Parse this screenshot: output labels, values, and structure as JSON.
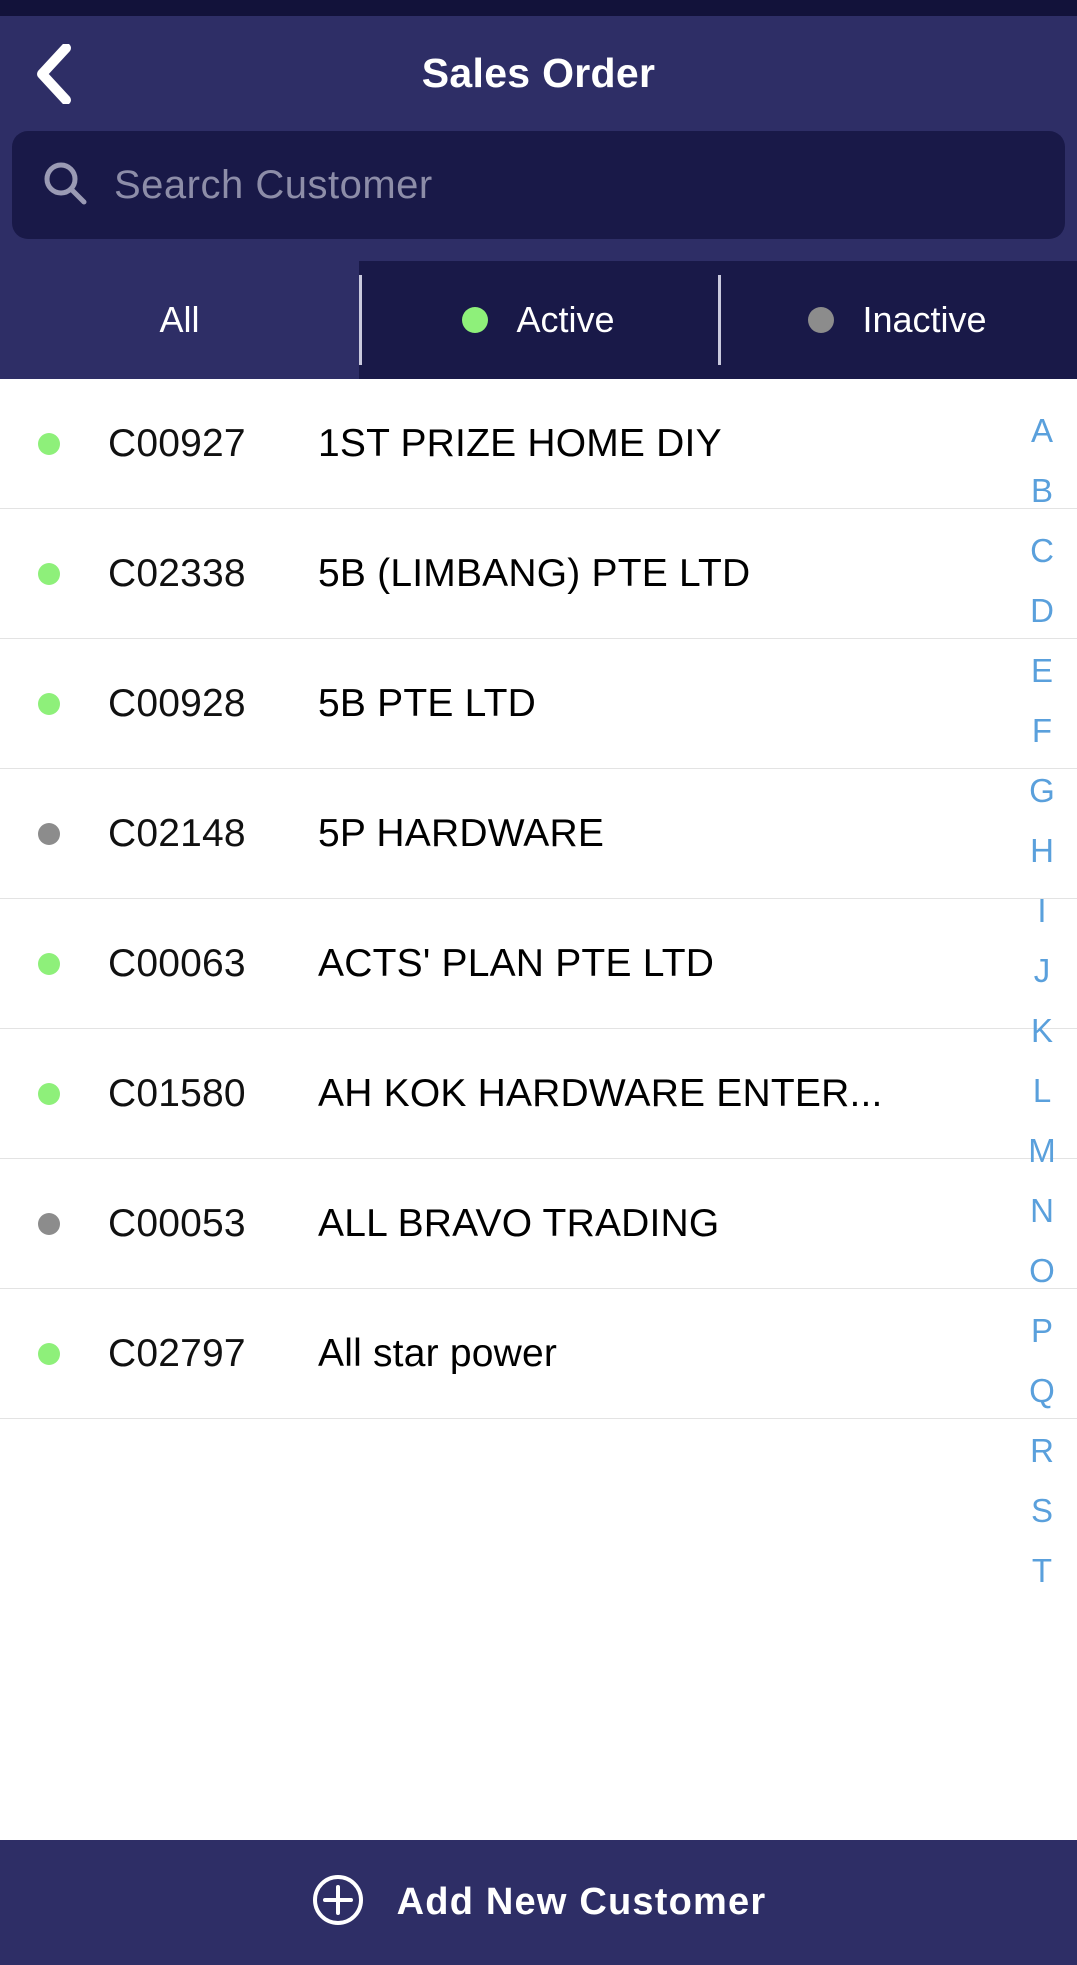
{
  "header": {
    "title": "Sales Order",
    "back_icon": "chevron-left-icon",
    "background_color": "#2e2e66"
  },
  "search": {
    "icon": "search-icon",
    "placeholder": "Search Customer",
    "value": ""
  },
  "tabs": [
    {
      "label": "All",
      "dot": null,
      "selected": false
    },
    {
      "label": "Active",
      "dot": "#8ef07a",
      "selected": true
    },
    {
      "label": "Inactive",
      "dot": "#8c8c8c",
      "selected": true
    }
  ],
  "colors": {
    "active_dot": "#8ef07a",
    "inactive_dot": "#8c8c8c",
    "accent_navy": "#2e2e66",
    "dark_navy": "#191948",
    "index_blue": "#5aa0dc"
  },
  "customers": [
    {
      "code": "C00927",
      "name": "1ST PRIZE HOME DIY",
      "status": "active"
    },
    {
      "code": "C02338",
      "name": "5B (LIMBANG) PTE LTD",
      "status": "active"
    },
    {
      "code": "C00928",
      "name": "5B PTE LTD",
      "status": "active"
    },
    {
      "code": "C02148",
      "name": "5P HARDWARE",
      "status": "inactive"
    },
    {
      "code": "C00063",
      "name": "ACTS' PLAN PTE LTD",
      "status": "active"
    },
    {
      "code": "C01580",
      "name": "AH KOK HARDWARE ENTER...",
      "status": "active"
    },
    {
      "code": "C00053",
      "name": "ALL BRAVO TRADING",
      "status": "inactive"
    },
    {
      "code": "C02797",
      "name": "All star power",
      "status": "active"
    }
  ],
  "alphabet_index": [
    "A",
    "B",
    "C",
    "D",
    "E",
    "F",
    "G",
    "H",
    "I",
    "J",
    "K",
    "L",
    "M",
    "N",
    "O",
    "P",
    "Q",
    "R",
    "S",
    "T"
  ],
  "bottom_bar": {
    "icon": "plus-circle-icon",
    "label": "Add New Customer"
  }
}
